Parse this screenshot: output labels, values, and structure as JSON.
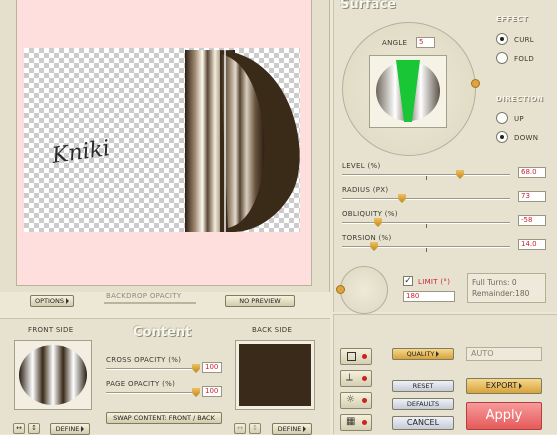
{
  "preview": {
    "watermark": "Kniki",
    "options_label": "OPTIONS",
    "backdrop_opacity_label": "BACKDROP OPACITY",
    "no_preview_label": "NO PREVIEW"
  },
  "surface": {
    "title": "Surface",
    "angle_label": "ANGLE",
    "angle_value": "5",
    "effect_label": "EFFECT",
    "effect_options": [
      "CURL",
      "FOLD"
    ],
    "effect_selected": "CURL",
    "direction_label": "DIRECTION",
    "direction_options": [
      "UP",
      "DOWN"
    ],
    "direction_selected": "DOWN",
    "level_label": "LEVEL (%)",
    "level_value": "68.0",
    "radius_label": "RADIUS (PX)",
    "radius_value": "73",
    "obliquity_label": "OBLIQUITY (%)",
    "obliquity_value": "-58",
    "torsion_label": "TORSION (%)",
    "torsion_value": "14.0",
    "limit_label": "LIMIT (°)",
    "limit_value": "180",
    "full_turns": "Full Turns:  0",
    "remainder": "Remainder:180",
    "accent": "#c23333"
  },
  "content": {
    "title": "Content",
    "front_side_label": "FRONT SIDE",
    "back_side_label": "BACK SIDE",
    "cross_opacity_label": "CROSS OPACITY (%)",
    "cross_opacity_value": "100",
    "page_opacity_label": "PAGE OPACITY (%)",
    "page_opacity_value": "100",
    "swap_label": "SWAP CONTENT: FRONT / BACK",
    "define_label": "DEFINE",
    "back_color": "#3a2a1a"
  },
  "actions": {
    "quality_label": "QUALITY",
    "quality_value": "AUTO",
    "reset_label": "RESET",
    "export_label": "EXPORT",
    "defaults_label": "DEFAULTS",
    "cancel_label": "CANCEL",
    "apply_label": "Apply",
    "apply_color": "#ef6a6a"
  }
}
